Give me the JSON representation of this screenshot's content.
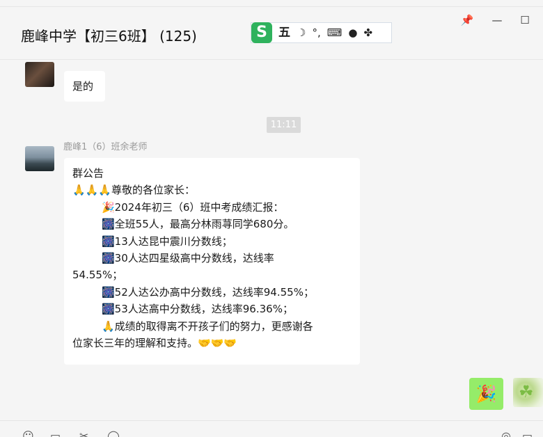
{
  "window": {
    "title": "鹿峰中学【初三6班】 (125)",
    "pin_icon": "pin-icon",
    "minimize_icon": "minimize-icon",
    "maximize_icon": "maximize-icon"
  },
  "ime": {
    "logo": "S",
    "mode": "五",
    "items": [
      "moon-icon",
      "punctuation-icon",
      "keyboard-icon",
      "user-icon",
      "grid-icon"
    ],
    "punct": "°,"
  },
  "chat": {
    "msg1": {
      "text": "是的"
    },
    "time": "11:11",
    "msg2": {
      "sender": "鹿峰1（6）班余老师",
      "lines": [
        "群公告",
        "🙏🙏🙏尊敬的各位家长：",
        "🎉2024年初三（6）班中考成绩汇报：",
        "🎆全班55人，最高分林雨荨同学680分。",
        "🎆13人达昆中震川分数线；",
        "🎆30人达四星级高中分数线，达线率",
        "54.55%；",
        "🎆52人达公办高中分数线，达线率94.55%；",
        "🎆53人达高中分数线，达线率96.36%；",
        "🙏成绩的取得离不开孩子们的努力，更感谢各",
        "位家长三年的理解和支持。🤝🤝🤝"
      ]
    },
    "msg3": {
      "text": "🎉"
    }
  },
  "colors": {
    "self_bubble": "#95ec69",
    "other_bubble": "#ffffff",
    "background": "#f5f5f5",
    "ime_logo": "#2fb25d"
  }
}
